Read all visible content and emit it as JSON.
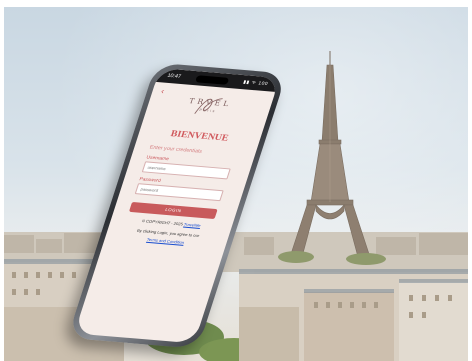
{
  "status_bar": {
    "time": "10:47",
    "icons": "▮▮ ᯤ 100"
  },
  "app": {
    "back_glyph": "‹",
    "logo": {
      "word": "TRVEL",
      "sub": "Paris"
    },
    "title": "BIENVENUE",
    "subtitle": "Enter your credentials",
    "username": {
      "label": "Username",
      "placeholder": "username",
      "value": ""
    },
    "password": {
      "label": "Password",
      "placeholder": "password",
      "value": ""
    },
    "login_button": "LOGIN",
    "copyright_prefix": "© COPYRIGHT - 2025",
    "copyright_link": "TravelMe",
    "agree_text": "By clicking Login, you agree to our",
    "terms_link": "Terms and Condition"
  },
  "colors": {
    "accent": "#c85a5c",
    "screen_bg": "#f5ece8",
    "link": "#1b4fd0"
  },
  "icons": {
    "back": "chevron-left-icon",
    "signal": "signal-icon",
    "wifi": "wifi-icon",
    "battery": "battery-icon"
  }
}
